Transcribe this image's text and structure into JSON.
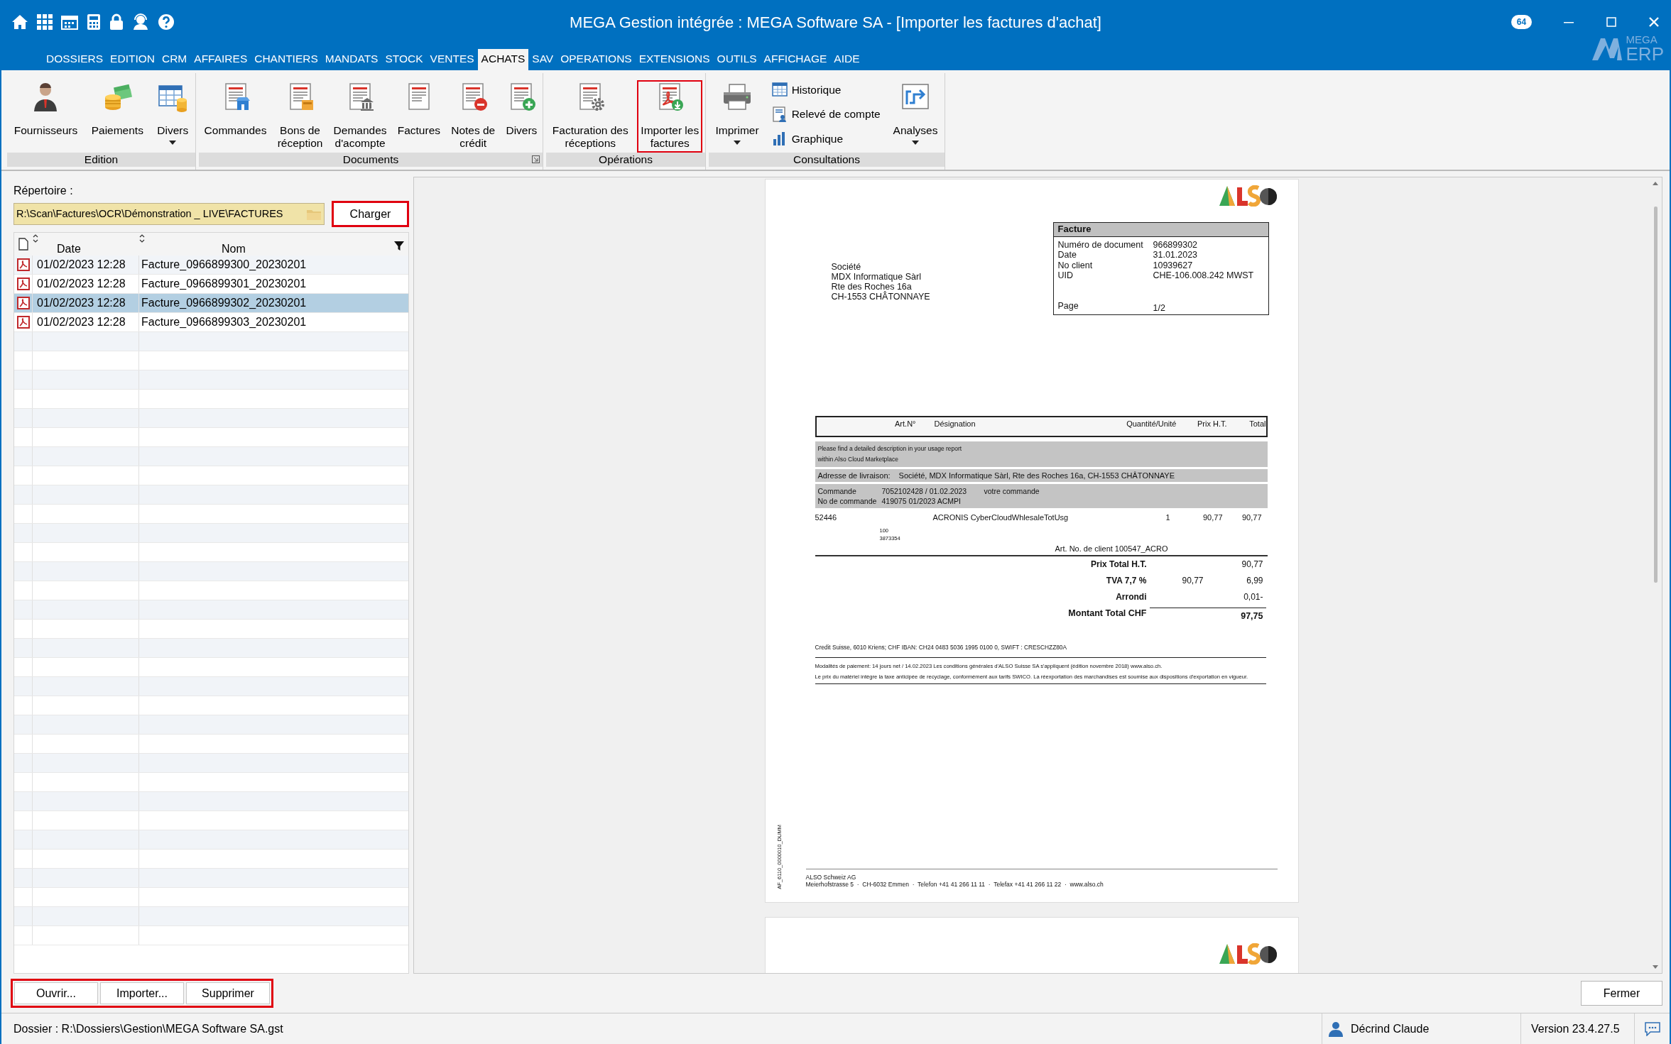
{
  "title_bar": {
    "title": "MEGA Gestion intégrée : MEGA Software SA - [Importer les factures d'achat]",
    "badge": "64"
  },
  "logo": {
    "top": "MEGA",
    "bottom": "ERP"
  },
  "menu_tabs": [
    {
      "label": "DOSSIERS",
      "selected": false
    },
    {
      "label": "EDITION",
      "selected": false
    },
    {
      "label": "CRM",
      "selected": false
    },
    {
      "label": "AFFAIRES",
      "selected": false
    },
    {
      "label": "CHANTIERS",
      "selected": false
    },
    {
      "label": "MANDATS",
      "selected": false
    },
    {
      "label": "STOCK",
      "selected": false
    },
    {
      "label": "VENTES",
      "selected": false
    },
    {
      "label": "ACHATS",
      "selected": true
    },
    {
      "label": "SAV",
      "selected": false
    },
    {
      "label": "OPERATIONS",
      "selected": false
    },
    {
      "label": "EXTENSIONS",
      "selected": false
    },
    {
      "label": "OUTILS",
      "selected": false
    },
    {
      "label": "AFFICHAGE",
      "selected": false
    },
    {
      "label": "AIDE",
      "selected": false
    }
  ],
  "ribbon": [
    {
      "label": "Edition",
      "launcher": false,
      "items": [
        {
          "kind": "large",
          "lines": [
            "Fournisseurs"
          ],
          "dropdown": false,
          "highlighted": false
        },
        {
          "kind": "large",
          "lines": [
            "Paiements"
          ],
          "dropdown": false,
          "highlighted": false
        },
        {
          "kind": "large",
          "lines": [
            "Divers"
          ],
          "dropdown": true,
          "highlighted": false
        }
      ]
    },
    {
      "label": "Documents",
      "launcher": true,
      "items": [
        {
          "kind": "large",
          "lines": [
            "Commandes"
          ],
          "dropdown": false,
          "highlighted": false
        },
        {
          "kind": "large",
          "lines": [
            "Bons de",
            "réception"
          ],
          "dropdown": false,
          "highlighted": false
        },
        {
          "kind": "large",
          "lines": [
            "Demandes",
            "d'acompte"
          ],
          "dropdown": false,
          "highlighted": false
        },
        {
          "kind": "large",
          "lines": [
            "Factures"
          ],
          "dropdown": false,
          "highlighted": false
        },
        {
          "kind": "large",
          "lines": [
            "Notes de",
            "crédit"
          ],
          "dropdown": false,
          "highlighted": false
        },
        {
          "kind": "large",
          "lines": [
            "Divers"
          ],
          "dropdown": false,
          "highlighted": false
        }
      ]
    },
    {
      "label": "Opérations",
      "launcher": false,
      "items": [
        {
          "kind": "large",
          "lines": [
            "Facturation des",
            "réceptions"
          ],
          "dropdown": false,
          "highlighted": false
        },
        {
          "kind": "large",
          "lines": [
            "Importer les",
            "factures"
          ],
          "dropdown": false,
          "highlighted": true
        }
      ]
    },
    {
      "label": "Consultations",
      "launcher": false,
      "items": [
        {
          "kind": "large",
          "lines": [
            "Imprimer"
          ],
          "dropdown": true,
          "highlighted": false
        },
        {
          "kind": "small",
          "lines": [
            "Historique"
          ],
          "highlighted": false
        },
        {
          "kind": "small",
          "lines": [
            "Relevé de compte"
          ],
          "highlighted": false
        },
        {
          "kind": "small",
          "lines": [
            "Graphique"
          ],
          "highlighted": false
        },
        {
          "kind": "large",
          "lines": [
            "Analyses"
          ],
          "dropdown": true,
          "highlighted": false
        }
      ]
    }
  ],
  "directory": {
    "label": "Répertoire :",
    "value": "R:\\Scan\\Factures\\OCR\\Démonstration _ LIVE\\FACTURES",
    "load_button": {
      "label": "Charger",
      "highlighted": true
    }
  },
  "file_list": {
    "columns": [
      "Date",
      "Nom"
    ],
    "rows": [
      {
        "date": "01/02/2023 12:28",
        "name": "Facture_0966899300_20230201",
        "selected": false
      },
      {
        "date": "01/02/2023 12:28",
        "name": "Facture_0966899301_20230201",
        "selected": false
      },
      {
        "date": "01/02/2023 12:28",
        "name": "Facture_0966899302_20230201",
        "selected": true
      },
      {
        "date": "01/02/2023 12:28",
        "name": "Facture_0966899303_20230201",
        "selected": false
      }
    ]
  },
  "document": {
    "invoice_box": {
      "title": "Facture",
      "fields": [
        {
          "label": "Numéro de document",
          "value": "966899302"
        },
        {
          "label": "Date",
          "value": "31.01.2023"
        },
        {
          "label": "No client",
          "value": "10939627"
        },
        {
          "label": "UID",
          "value": "CHE-106.008.242 MWST"
        }
      ],
      "page": {
        "label": "Page",
        "value": "1/2"
      }
    },
    "address": [
      "Société",
      "MDX Informatique Sàrl",
      "Rte des Roches 16a",
      "CH-1553 CHÂTONNAYE"
    ],
    "table_columns": [
      "Art.N°",
      "Désignation",
      "Quantité/Unité",
      "Prix H.T.",
      "Total"
    ],
    "notes": [
      "Please find a detailed description in your usage report",
      "within Also Cloud Marketplace"
    ],
    "delivery": {
      "label": "Adresse de livraison:",
      "value": "Société, MDX Informatique Sàrl, Rte des Roches 16a, CH-1553 CHÂTONNAYE"
    },
    "orders": [
      {
        "label": "Commande",
        "value": "7052102428 / 01.02.2023",
        "note": "votre commande"
      },
      {
        "label": "No de commande",
        "value": "419075 01/2023 ACMPI"
      }
    ],
    "line_item": {
      "article": "52446",
      "designation": "ACRONIS CyberCloudWhlesaleTotUsg",
      "quantity": "1",
      "price": "90,77",
      "total": "90,77",
      "sublines": [
        "100",
        "3873354"
      ],
      "client_article": "Art. No. de client 100547_ACRO"
    },
    "totals": [
      {
        "kind": "normal",
        "label": "Prix Total H.T.",
        "value": "90,77"
      },
      {
        "kind": "normal",
        "label": "TVA 7,7 %",
        "base": "90,77",
        "value": "6,99"
      },
      {
        "kind": "normal",
        "label": "Arrondi",
        "value": "0,01-"
      },
      {
        "kind": "grand",
        "label": "Montant Total CHF",
        "value": "97,75"
      }
    ],
    "bank": "Credit Suisse, 6010 Kriens; CHF IBAN: CH24 0483 5036 1995 0100 0, SWIFT : CRESCHZZ80A",
    "terms": [
      "Modalités de paiement: 14 jours net / 14.02.2023 Les conditions générales d'ALSO Suisse SA s'appliquent (édition novembre 2018) www.also.ch.",
      "Le prix du matériel intègre la taxe anticipée de recyclage, conformément aux tarifs SWICO. La réexportation des marchandises est soumise aux dispositions d'exportation en vigueur."
    ],
    "side_code": "AF_6110_0000010_DUMM",
    "footer": {
      "company": "ALSO Schweiz AG",
      "address": "Meierhofstrasse 5  ·  CH-6032 Emmen  ·  Telefon +41 41 266 11 11  ·  Telefax +41 41 266 11 22  ·  www.also.ch"
    }
  },
  "actions": {
    "highlighted": true,
    "buttons": [
      "Ouvrir...",
      "Importer...",
      "Supprimer"
    ]
  },
  "close_button": "Fermer",
  "status_bar": {
    "dossier": "Dossier : R:\\Dossiers\\Gestion\\MEGA Software SA.gst",
    "user": "Décrind Claude",
    "version": "Version 23.4.27.5"
  }
}
